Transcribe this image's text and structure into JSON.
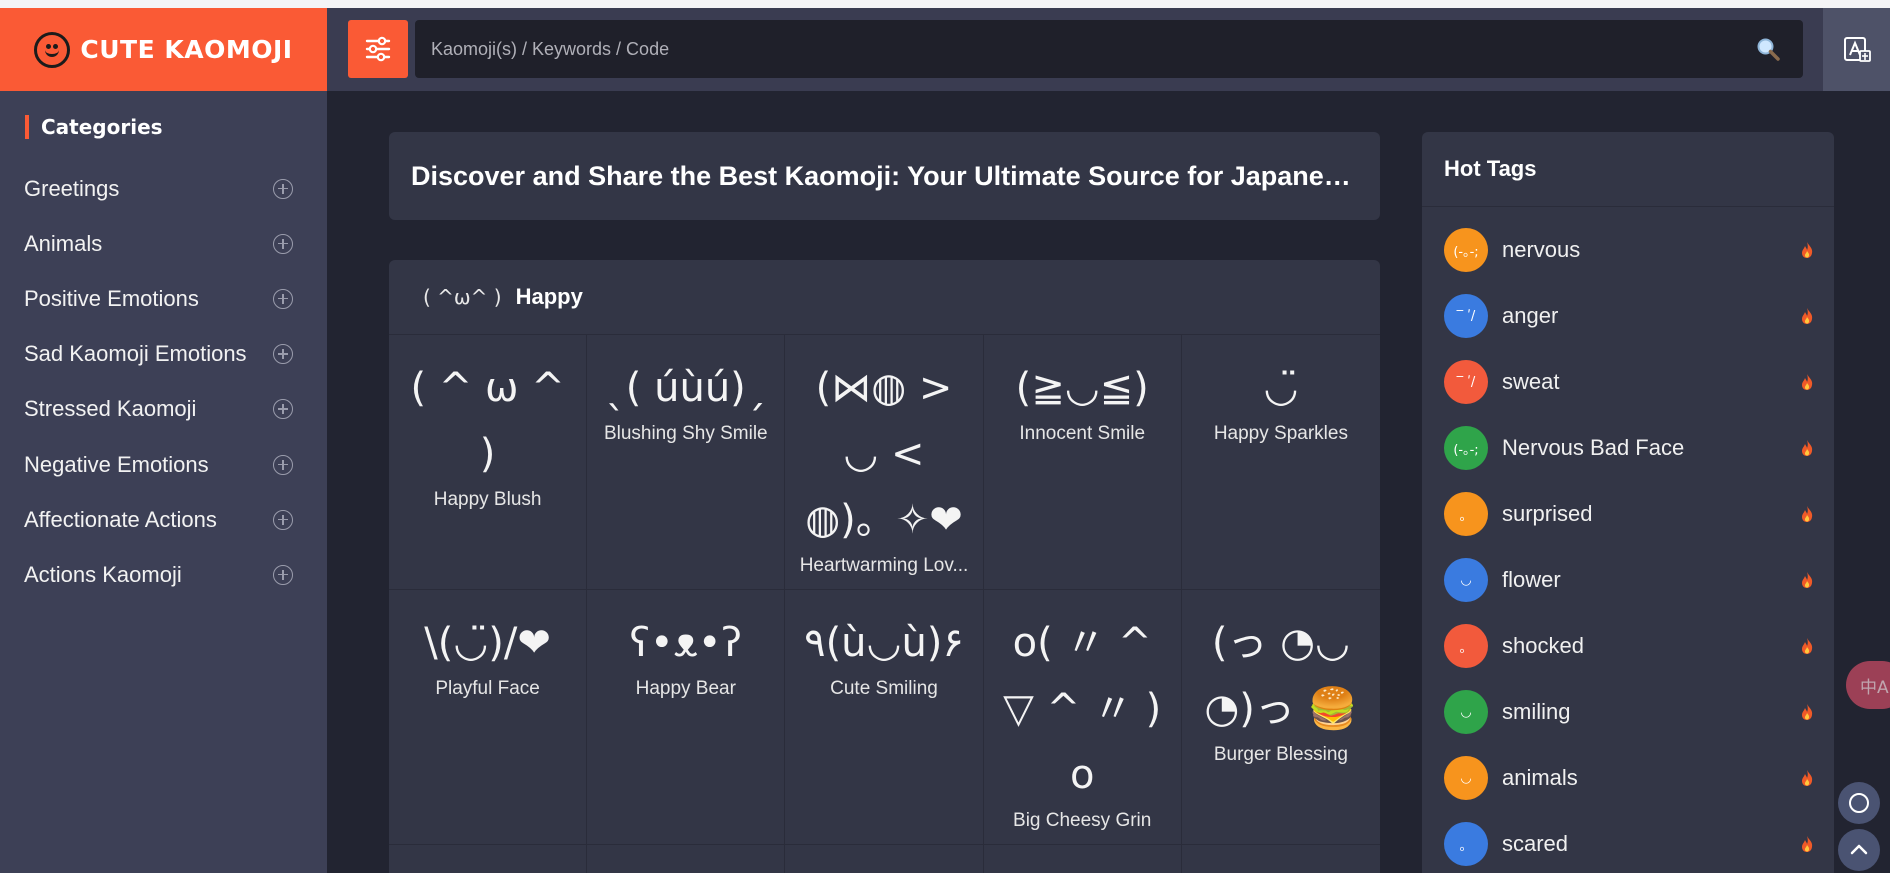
{
  "header": {
    "logo_text": "CUTE KAOMOJI",
    "search_placeholder": "Kaomoji(s) / Keywords / Code"
  },
  "sidebar": {
    "title": "Categories",
    "items": [
      {
        "label": "Greetings"
      },
      {
        "label": "Animals"
      },
      {
        "label": "Positive Emotions"
      },
      {
        "label": "Sad Kaomoji Emotions"
      },
      {
        "label": "Stressed Kaomoji"
      },
      {
        "label": "Negative Emotions"
      },
      {
        "label": "Affectionate Actions"
      },
      {
        "label": "Actions Kaomoji"
      }
    ]
  },
  "main": {
    "banner_title": "Discover and Share the Best Kaomoji: Your Ultimate Source for Japanese E...",
    "section": {
      "kaomoji": "( ^ω^ )",
      "title": "Happy",
      "cells": [
        {
          "kaomoji": "( ^ ω ^ )",
          "label": "Happy Blush"
        },
        {
          "kaomoji": "ˎ( úùú)ˏ",
          "label": "Blushing Shy Smile"
        },
        {
          "kaomoji": "(⋈◍ > ◡ < ◍)。✧❤",
          "label": "Heartwarming Lov..."
        },
        {
          "kaomoji": "(≧◡≦)",
          "label": "Innocent Smile"
        },
        {
          "kaomoji": "◡̈",
          "label": "Happy Sparkles"
        },
        {
          "kaomoji": "\\(◡̈)/❤",
          "label": "Playful Face"
        },
        {
          "kaomoji": "ʕ•ᴥ•ʔ",
          "label": "Happy Bear"
        },
        {
          "kaomoji": "٩(ù◡ù)۶",
          "label": "Cute Smiling"
        },
        {
          "kaomoji": "o( 〃 ^ ▽ ^ 〃 )o",
          "label": "Big Cheesy Grin"
        },
        {
          "kaomoji": "(っ ◔◡◔)っ 🍔",
          "label": "Burger Blessing"
        }
      ]
    }
  },
  "hot_tags": {
    "title": "Hot Tags",
    "items": [
      {
        "name": "nervous",
        "avatar": "(-｡-;",
        "color": "#f7941d"
      },
      {
        "name": "anger",
        "avatar": "‾ ʹ/",
        "color": "#3a7be0"
      },
      {
        "name": "sweat",
        "avatar": "‾ ʹ/",
        "color": "#f25a3c"
      },
      {
        "name": "Nervous Bad Face",
        "avatar": "(-｡-;",
        "color": "#2fa44a"
      },
      {
        "name": "surprised",
        "avatar": "。",
        "color": "#f7941d"
      },
      {
        "name": "flower",
        "avatar": "◡",
        "color": "#3a7be0"
      },
      {
        "name": "shocked",
        "avatar": "。",
        "color": "#f25a3c"
      },
      {
        "name": "smiling",
        "avatar": "◡",
        "color": "#2fa44a"
      },
      {
        "name": "animals",
        "avatar": "◡",
        "color": "#f7941d"
      },
      {
        "name": "scared",
        "avatar": "。",
        "color": "#3a7be0"
      }
    ]
  },
  "floating": {
    "translate_label": "中A"
  },
  "colors": {
    "accent": "#fa5a35",
    "background": "#222431",
    "sidebar": "#3d4056",
    "panel": "#333646"
  }
}
